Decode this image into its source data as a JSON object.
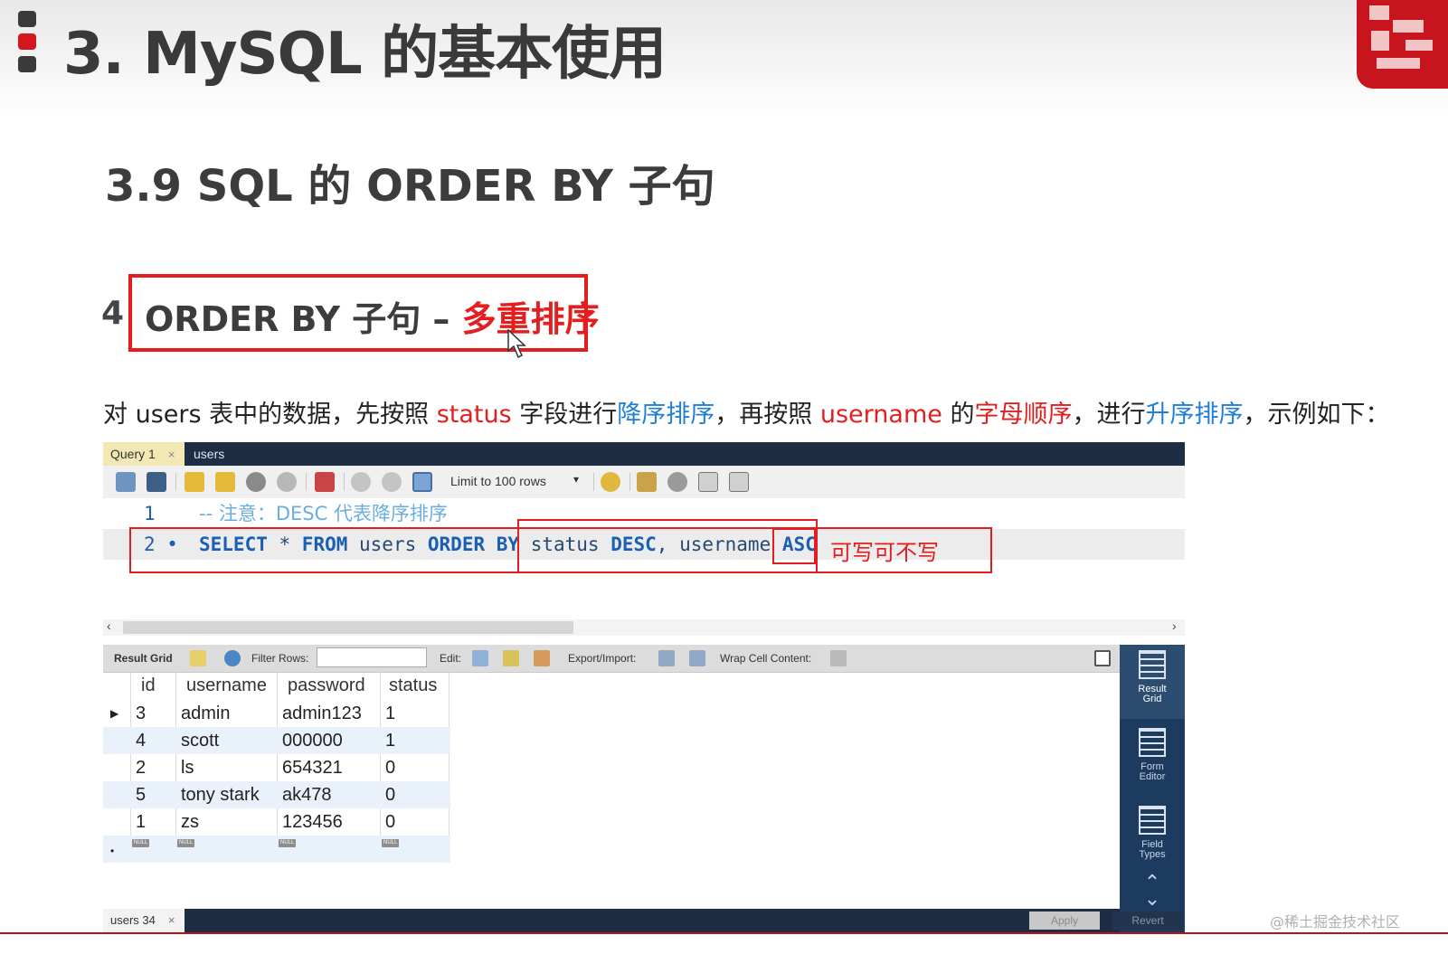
{
  "slide": {
    "title": "3. MySQL 的基本使用",
    "subtitle": "3.9 SQL 的 ORDER BY 子句",
    "section_number": "4",
    "section_title": "ORDER BY 子句 – ",
    "section_title_highlight": "多重排序",
    "desc_parts": {
      "p1": "对 users 表中的数据，先按照 ",
      "p2": "status",
      "p3": " 字段进行",
      "p4": "降序排序",
      "p5": "，再按照 ",
      "p6": "username",
      "p7": " 的",
      "p8": "字母顺序",
      "p9": "，进行",
      "p10": "升序排序",
      "p11": "，示例如下："
    },
    "note": "可写可不写",
    "watermark": "@稀土掘金技术社区",
    "colors": {
      "accent_red": "#e41e1e",
      "accent_blue": "#1f7fd6",
      "navy": "#1d2d44"
    }
  },
  "workbench": {
    "tabs": [
      {
        "label": "Query 1",
        "close": "×"
      },
      {
        "label": "users"
      }
    ],
    "toolbar": {
      "limit_label": "Limit to 100 rows",
      "icons": [
        "open-folder-icon",
        "save-icon",
        "execute-icon",
        "execute-current-icon",
        "explain-icon",
        "stop-icon",
        "toggle-icon",
        "commit-icon",
        "rollback-icon",
        "autocommit-icon",
        "beautify-icon",
        "search-icon",
        "invisible-chars-icon",
        "wrap-icon"
      ]
    },
    "editor": {
      "lines": [
        {
          "num": "1",
          "text": "-- 注意：DESC 代表降序排序"
        },
        {
          "num": "2 •",
          "kw1": "SELECT",
          "t1": " * ",
          "kw2": "FROM",
          "t2": " users ",
          "kw3": "ORDER BY",
          "t3": " status ",
          "kw4": "DESC",
          "t4": ", username ",
          "kw5": "ASC"
        }
      ]
    },
    "result_toolbar": {
      "result_grid": "Result Grid",
      "filter_rows": "Filter Rows:",
      "edit": "Edit:",
      "export_import": "Export/Import:",
      "wrap_cell": "Wrap Cell Content:"
    },
    "grid": {
      "columns": [
        "id",
        "username",
        "password",
        "status"
      ],
      "rows": [
        [
          "3",
          "admin",
          "admin123",
          "1"
        ],
        [
          "4",
          "scott",
          "000000",
          "1"
        ],
        [
          "2",
          "ls",
          "654321",
          "0"
        ],
        [
          "5",
          "tony stark",
          "ak478",
          "0"
        ],
        [
          "1",
          "zs",
          "123456",
          "0"
        ]
      ],
      "null_label": "NULL"
    },
    "side_panel": [
      {
        "label": "Result\nGrid"
      },
      {
        "label": "Form\nEditor"
      },
      {
        "label": "Field\nTypes"
      }
    ],
    "bottom": {
      "tab_label": "users 34",
      "close": "×",
      "apply": "Apply",
      "revert": "Revert"
    }
  }
}
